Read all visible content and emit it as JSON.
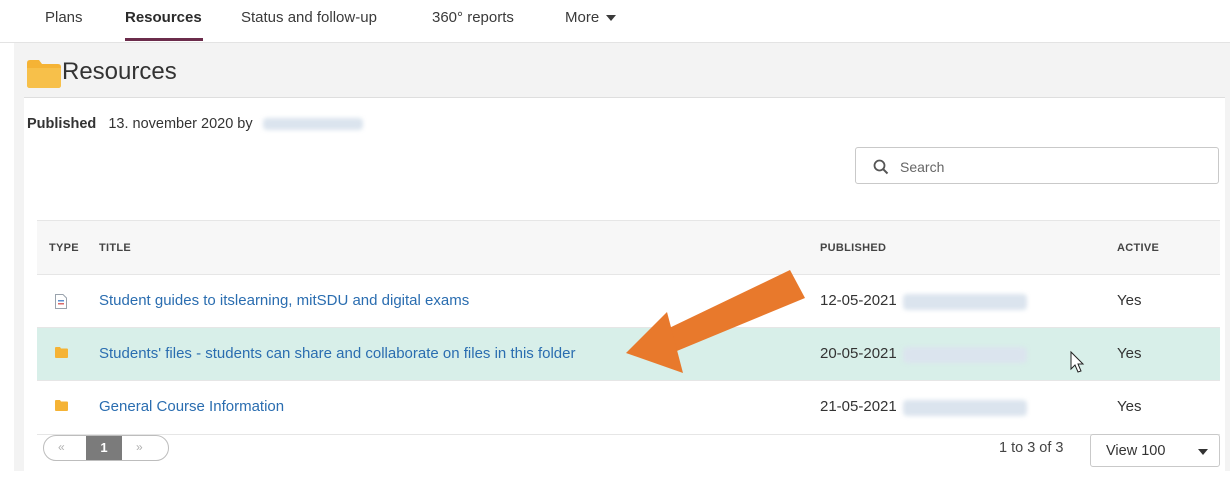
{
  "nav": {
    "tabs": [
      {
        "label": "Plans"
      },
      {
        "label": "Resources"
      },
      {
        "label": "Status and follow-up"
      },
      {
        "label": "360° reports"
      },
      {
        "label": "More"
      }
    ]
  },
  "page": {
    "title": "Resources",
    "published_label": "Published",
    "published_text": "13. november 2020 by"
  },
  "search": {
    "placeholder": "Search"
  },
  "table": {
    "headers": {
      "type": "TYPE",
      "title": "TITLE",
      "published": "PUBLISHED",
      "active": "ACTIVE"
    },
    "rows": [
      {
        "type_icon": "document-icon",
        "title": "Student guides to itslearning, mitSDU and digital exams",
        "published": "12-05-2021",
        "active": "Yes",
        "selected": false
      },
      {
        "type_icon": "folder-icon",
        "title": "Students' files - students can share and collaborate on files in this folder",
        "published": "20-05-2021",
        "active": "Yes",
        "selected": true
      },
      {
        "type_icon": "folder-icon",
        "title": "General Course Information",
        "published": "21-05-2021",
        "active": "Yes",
        "selected": false
      }
    ]
  },
  "pagination": {
    "prev": "«",
    "current_page": "1",
    "next": "»",
    "range_text": "1 to 3 of 3",
    "view_label": "View 100"
  },
  "colors": {
    "accent": "#6b2c4b",
    "link": "#2a6db0",
    "selected_row": "#d8efe9",
    "arrow": "#e8792c",
    "folder": "#f5b335"
  }
}
